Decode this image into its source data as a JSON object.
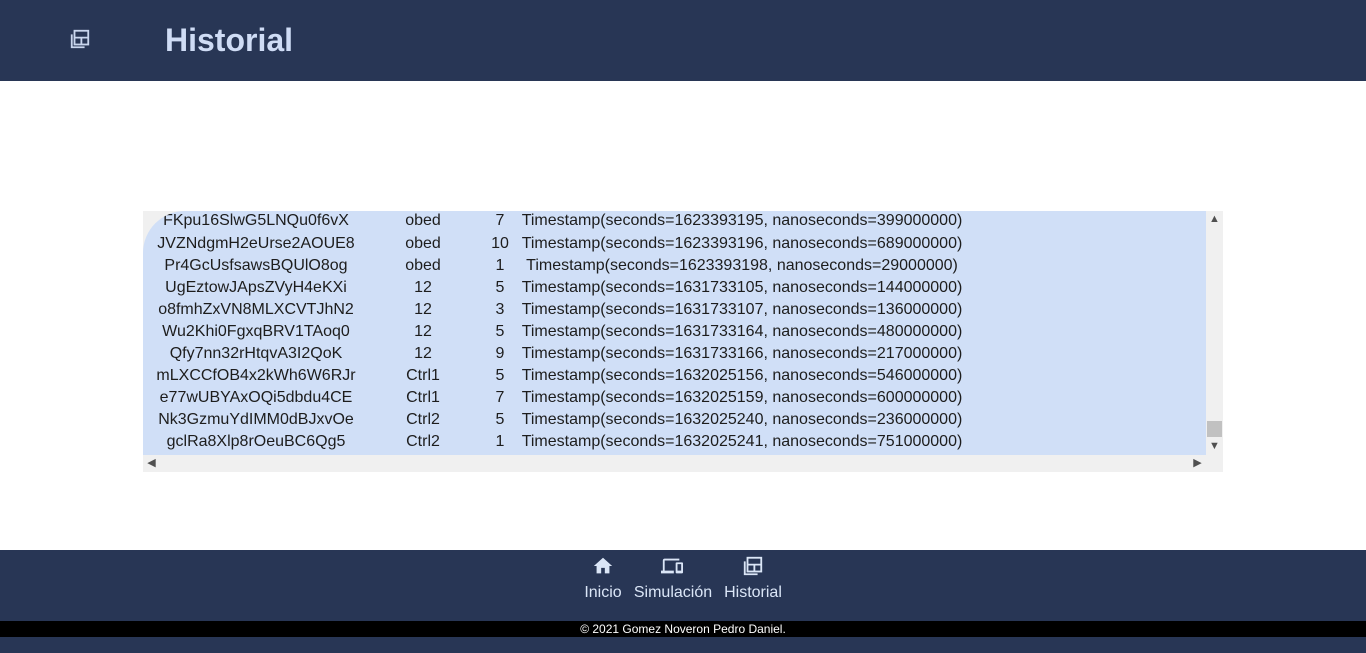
{
  "header": {
    "title": "Historial",
    "icon": "history-icon"
  },
  "table": {
    "rows": [
      {
        "id": "FKpu16SlwG5LNQu0f6vX",
        "user": "obed",
        "value": "7",
        "timestamp": "Timestamp(seconds=1623393195, nanoseconds=399000000)"
      },
      {
        "id": "JVZNdgmH2eUrse2AOUE8",
        "user": "obed",
        "value": "10",
        "timestamp": "Timestamp(seconds=1623393196, nanoseconds=689000000)"
      },
      {
        "id": "Pr4GcUsfsawsBQUlO8og",
        "user": "obed",
        "value": "1",
        "timestamp": "Timestamp(seconds=1623393198, nanoseconds=29000000)"
      },
      {
        "id": "UgEztowJApsZVyH4eKXi",
        "user": "12",
        "value": "5",
        "timestamp": "Timestamp(seconds=1631733105, nanoseconds=144000000)"
      },
      {
        "id": "o8fmhZxVN8MLXCVTJhN2",
        "user": "12",
        "value": "3",
        "timestamp": "Timestamp(seconds=1631733107, nanoseconds=136000000)"
      },
      {
        "id": "Wu2Khi0FgxqBRV1TAoq0",
        "user": "12",
        "value": "5",
        "timestamp": "Timestamp(seconds=1631733164, nanoseconds=480000000)"
      },
      {
        "id": "Qfy7nn32rHtqvA3I2QoK",
        "user": "12",
        "value": "9",
        "timestamp": "Timestamp(seconds=1631733166, nanoseconds=217000000)"
      },
      {
        "id": "mLXCCfOB4x2kWh6W6RJr",
        "user": "Ctrl1",
        "value": "5",
        "timestamp": "Timestamp(seconds=1632025156, nanoseconds=546000000)"
      },
      {
        "id": "e77wUBYAxOQi5dbdu4CE",
        "user": "Ctrl1",
        "value": "7",
        "timestamp": "Timestamp(seconds=1632025159, nanoseconds=600000000)"
      },
      {
        "id": "Nk3GzmuYdIMM0dBJxvOe",
        "user": "Ctrl2",
        "value": "5",
        "timestamp": "Timestamp(seconds=1632025240, nanoseconds=236000000)"
      },
      {
        "id": "gclRa8Xlp8rOeuBC6Qg5",
        "user": "Ctrl2",
        "value": "1",
        "timestamp": "Timestamp(seconds=1632025241, nanoseconds=751000000)"
      }
    ]
  },
  "scrollbars": {
    "up": "▲",
    "down": "▼",
    "left": "◀",
    "right": "▶"
  },
  "footer": {
    "nav": [
      {
        "label": "Inicio",
        "icon": "home-icon"
      },
      {
        "label": "Simulación",
        "icon": "devices-icon"
      },
      {
        "label": "Historial",
        "icon": "history-icon"
      }
    ],
    "copyright": "© 2021 Gomez Noveron Pedro Daniel."
  },
  "colors": {
    "header_bg": "#283655",
    "table_bg": "#d0dff7",
    "title_color": "#cfdcf5"
  }
}
